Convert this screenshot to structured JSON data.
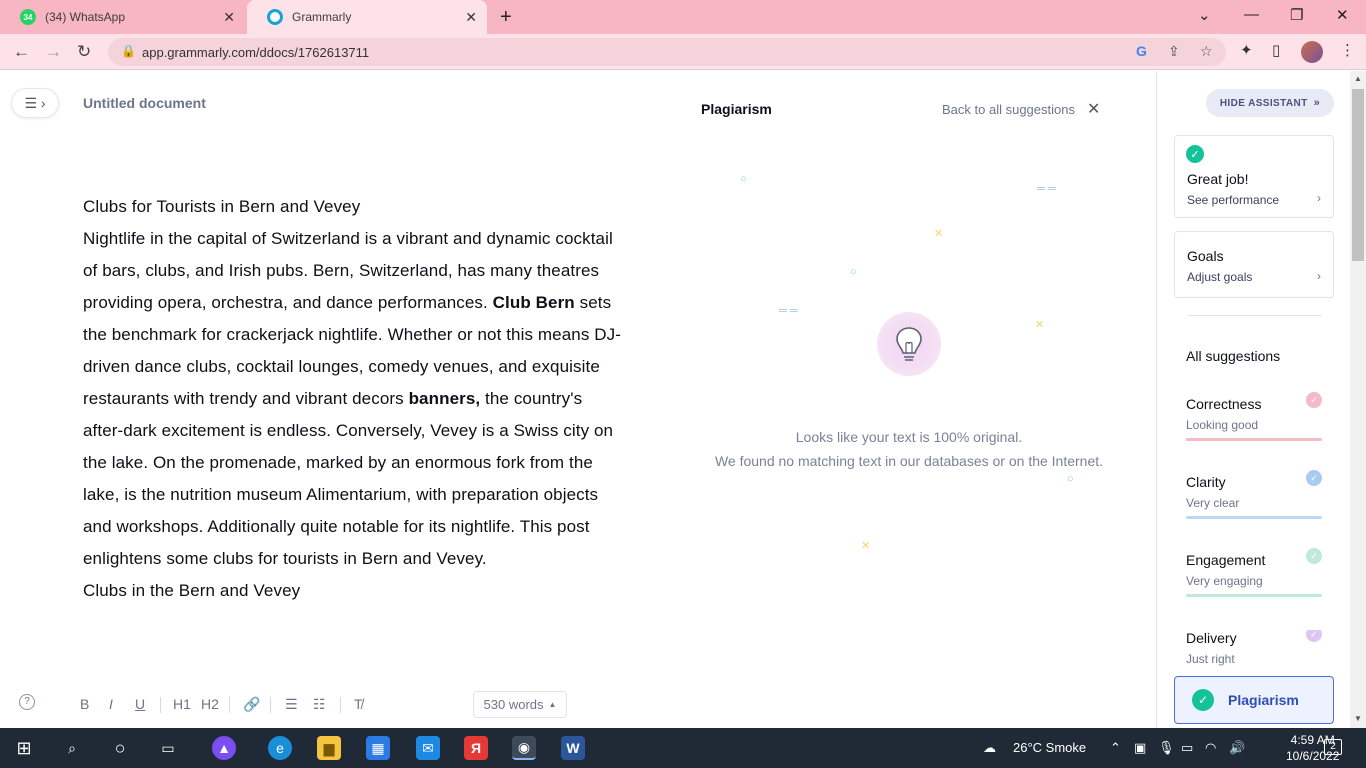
{
  "browser": {
    "tabs": [
      {
        "label": "(34) WhatsApp",
        "badge": "34",
        "active": false
      },
      {
        "label": "Grammarly",
        "active": true
      }
    ],
    "url": "app.grammarly.com/ddocs/1762613711"
  },
  "editor": {
    "doc_title": "Untitled document",
    "heading": "Clubs for Tourists in Bern and Vevey",
    "para_part1": "Nightlife in the capital of Switzerland is a vibrant and dynamic cocktail of bars, clubs, and Irish pubs. Bern, Switzerland, has many theatres providing opera, orchestra, and dance performances. ",
    "para_bold1": "Club Bern",
    "para_part2": " sets the benchmark for crackerjack nightlife. Whether or not this means DJ-driven dance clubs, cocktail lounges, comedy venues, and exquisite restaurants with trendy and vibrant decors ",
    "para_bold2": "banners,",
    "para_part3": " the country's after-dark excitement is endless. Conversely, Vevey is a Swiss city on the lake. On the promenade, marked by an enormous fork from the lake, is the nutrition museum Alimentarium, with preparation objects and workshops. Additionally quite notable for its nightlife. This post enlightens some clubs for tourists in Bern and Vevey.",
    "subheading": "Clubs in the Bern and Vevey",
    "toolbar": {
      "bold": "B",
      "italic": "I",
      "underline": "U",
      "h1": "H1",
      "h2": "H2",
      "word_count": "530 words"
    }
  },
  "plagiarism": {
    "title": "Plagiarism",
    "back": "Back to all suggestions",
    "message_line1": "Looks like your text is 100% original.",
    "message_line2": "We found no matching text in our databases or on the Internet."
  },
  "assistant": {
    "hide_label": "HIDE ASSISTANT",
    "great_job": "Great job!",
    "see_performance": "See performance",
    "goals": "Goals",
    "adjust_goals": "Adjust goals",
    "all_suggestions": "All suggestions",
    "categories": [
      {
        "name": "Correctness",
        "status": "Looking good",
        "color": "#f0839b"
      },
      {
        "name": "Clarity",
        "status": "Very clear",
        "color": "#7fb2ea"
      },
      {
        "name": "Engagement",
        "status": "Very engaging",
        "color": "#8ddbc2"
      },
      {
        "name": "Delivery",
        "status": "Just right",
        "color": "#c9a6ea"
      }
    ],
    "plagiarism_label": "Plagiarism"
  },
  "taskbar": {
    "weather": "26°C  Smoke",
    "time": "4:59 AM",
    "date": "10/6/2022",
    "notifications": "2"
  },
  "colors": {
    "grammarly_green": "#15c39a",
    "tab_bar": "#f7b6c2",
    "accent_blue": "#4a6ee0"
  }
}
